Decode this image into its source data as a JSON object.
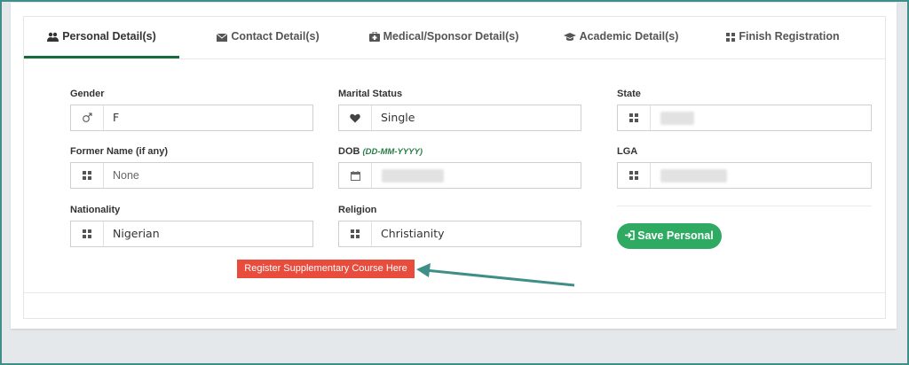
{
  "tabs": [
    {
      "label": "Personal Detail(s)",
      "icon": "users-icon"
    },
    {
      "label": "Contact Detail(s)",
      "icon": "envelope-icon"
    },
    {
      "label": "Medical/Sponsor Detail(s)",
      "icon": "medkit-icon"
    },
    {
      "label": "Academic Detail(s)",
      "icon": "graduation-cap-icon"
    },
    {
      "label": "Finish Registration",
      "icon": "grid-icon"
    }
  ],
  "form": {
    "gender": {
      "label": "Gender",
      "value": "F"
    },
    "marital": {
      "label": "Marital Status",
      "value": "Single"
    },
    "state": {
      "label": "State",
      "value": ""
    },
    "former_name": {
      "label": "Former Name (if any)",
      "value": "None"
    },
    "dob": {
      "label": "DOB",
      "hint": "(DD-MM-YYYY)",
      "value": ""
    },
    "lga": {
      "label": "LGA",
      "value": ""
    },
    "nationality": {
      "label": "Nationality",
      "value": "Nigerian"
    },
    "religion": {
      "label": "Religion",
      "value": "Christianity"
    }
  },
  "save_button": "Save Personal",
  "register_button": "Register Supplementary Course Here",
  "colors": {
    "accent": "#2eaa62",
    "tab_underline": "#1a6b3c",
    "register": "#e74c3c",
    "arrow": "#3f8f88"
  }
}
